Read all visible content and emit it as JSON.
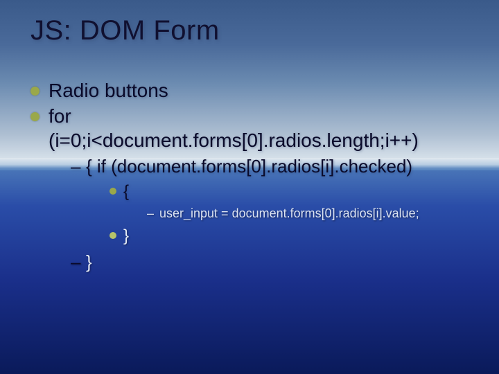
{
  "title": "JS: DOM Form",
  "bullets": {
    "l1a": "Radio buttons",
    "l1b_for": "for",
    "l1b_cond": "(i=0;i<document.forms[0].radios.length;i++)",
    "l2a": "{ if (document.forms[0].radios[i].checked)",
    "l3a": "{",
    "l4a": "user_input = document.forms[0].radios[i].value;",
    "l3b": "}",
    "l2b": "}"
  }
}
